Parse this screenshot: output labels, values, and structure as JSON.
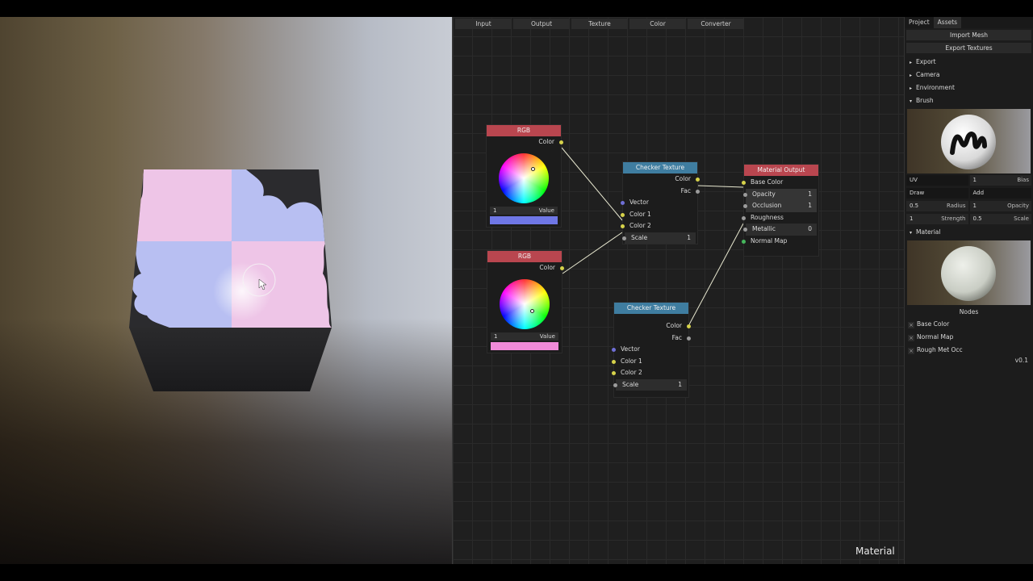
{
  "editor": {
    "tabs": [
      "Input",
      "Output",
      "Texture",
      "Color",
      "Converter"
    ],
    "mode_label": "Material",
    "nodes": {
      "rgb_top": {
        "title": "RGB",
        "output": "Color",
        "value_num": "1",
        "value_label": "Value",
        "swatch_color": "#6f77e6"
      },
      "rgb_bottom": {
        "title": "RGB",
        "output": "Color",
        "value_num": "1",
        "value_label": "Value",
        "swatch_color": "#f08ad8"
      },
      "checker_top": {
        "title": "Checker Texture",
        "outputs": [
          "Color",
          "Fac"
        ],
        "inputs": [
          "Vector",
          "Color 1",
          "Color 2"
        ],
        "scale_label": "Scale",
        "scale_value": "1"
      },
      "checker_bottom": {
        "title": "Checker Texture",
        "outputs": [
          "Color",
          "Fac"
        ],
        "inputs": [
          "Vector",
          "Color 1",
          "Color 2"
        ],
        "scale_label": "Scale",
        "scale_value": "1"
      },
      "material_output": {
        "title": "Material Output",
        "base_color": "Base Color",
        "opacity_label": "Opacity",
        "opacity_value": "1",
        "occlusion_label": "Occlusion",
        "occlusion_value": "1",
        "roughness": "Roughness",
        "metallic_label": "Metallic",
        "metallic_value": "0",
        "normal_map": "Normal Map"
      }
    }
  },
  "panel": {
    "tabs": [
      "Project",
      "Assets"
    ],
    "import_mesh": "Import Mesh",
    "export_textures": "Export Textures",
    "sections": {
      "export": "Export",
      "camera": "Camera",
      "environment": "Environment",
      "brush": "Brush",
      "material": "Material"
    },
    "brush": {
      "uv": "UV",
      "bias_num": "1",
      "bias_label": "Bias",
      "draw": "Draw",
      "add": "Add",
      "radius_num": "0.5",
      "radius_label": "Radius",
      "opacity_num": "1",
      "opacity_label": "Opacity",
      "strength_num": "1",
      "strength_label": "Strength",
      "scale_num": "0.5",
      "scale_label": "Scale"
    },
    "nodes_label": "Nodes",
    "checks": [
      "Base Color",
      "Normal Map",
      "Rough Met Occ"
    ],
    "version": "v0.1"
  }
}
